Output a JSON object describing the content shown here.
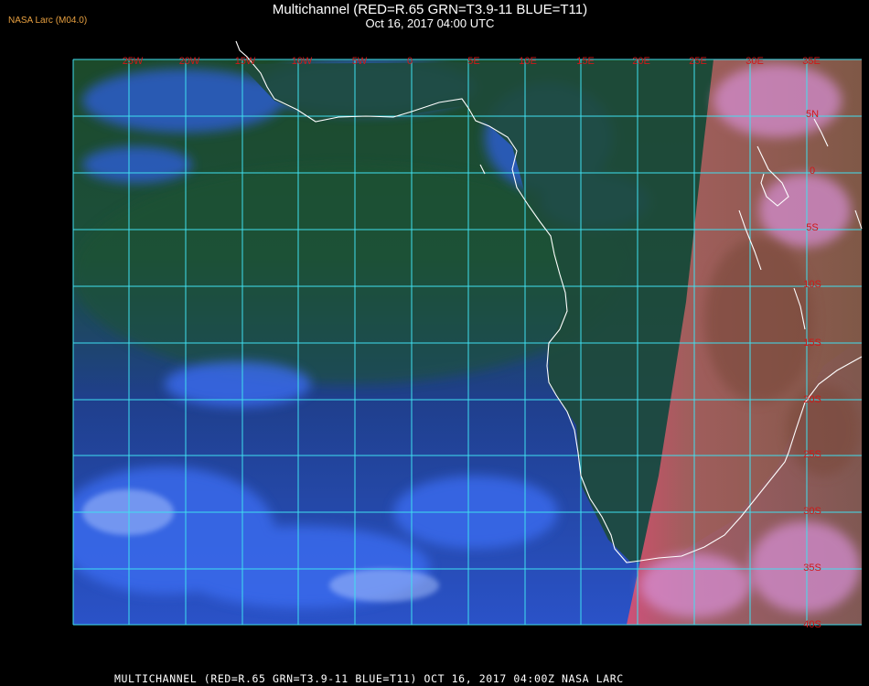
{
  "header": {
    "corner_label": "NASA Larc (M04.0)",
    "title": "Multichannel (RED=R.65 GRN=T3.9-11 BLUE=T11)",
    "subtitle": "Oct 16, 2017 04:00 UTC"
  },
  "footer": {
    "text": "MULTICHANNEL (RED=R.65 GRN=T3.9-11 BLUE=T11) OCT 16, 2017 04:00Z  NASA LARC"
  },
  "map": {
    "longitude_labels": [
      "25W",
      "20W",
      "15W",
      "10W",
      "5W",
      "0",
      "5E",
      "10E",
      "15E",
      "20E",
      "25E",
      "30E",
      "35E"
    ],
    "latitude_labels": [
      "5N",
      "0",
      "5S",
      "10S",
      "15S",
      "20S",
      "25S",
      "30S",
      "35S",
      "40S"
    ],
    "colors": {
      "grid": "#3fe0f0",
      "coastline": "#ffffff",
      "grid_label": "#d01818",
      "ocean_deep": "#1f3f9e",
      "ocean_green": "#1e4a26",
      "cloud_blue": "#2f60e6",
      "land_night": "#7a4a3a",
      "day_pink": "#d890d8"
    }
  }
}
